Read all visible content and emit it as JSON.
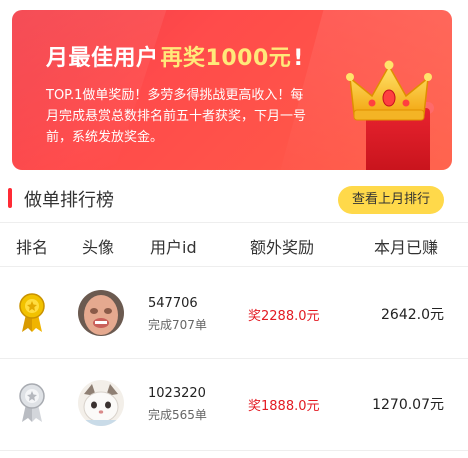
{
  "banner": {
    "title_prefix": "月最佳用户",
    "title_highlight": "再奖1000元",
    "title_suffix": "!",
    "body": "TOP.1做单奖励！多劳多得挑战更高收入！每月完成悬赏总数排名前五十者获奖，下月一号前，系统发放奖金。"
  },
  "section": {
    "title": "做单排行榜",
    "prev_month_button": "查看上月排行"
  },
  "table": {
    "headers": [
      "排名",
      "头像",
      "用户id",
      "额外奖励",
      "本月已赚"
    ],
    "rows": [
      {
        "medal": "gold",
        "user_id": "547706",
        "completed": "完成707单",
        "bonus": "奖2288.0元",
        "earned": "2642.0元"
      },
      {
        "medal": "silver",
        "user_id": "1023220",
        "completed": "完成565单",
        "bonus": "奖1888.0元",
        "earned": "1270.07元"
      }
    ]
  },
  "colors": {
    "accent_red": "#e31b23",
    "banner_red": "#f33a45",
    "highlight_yellow": "#ffd94a"
  },
  "icons": [
    "crown-icon",
    "gold-medal-icon",
    "silver-medal-icon"
  ]
}
